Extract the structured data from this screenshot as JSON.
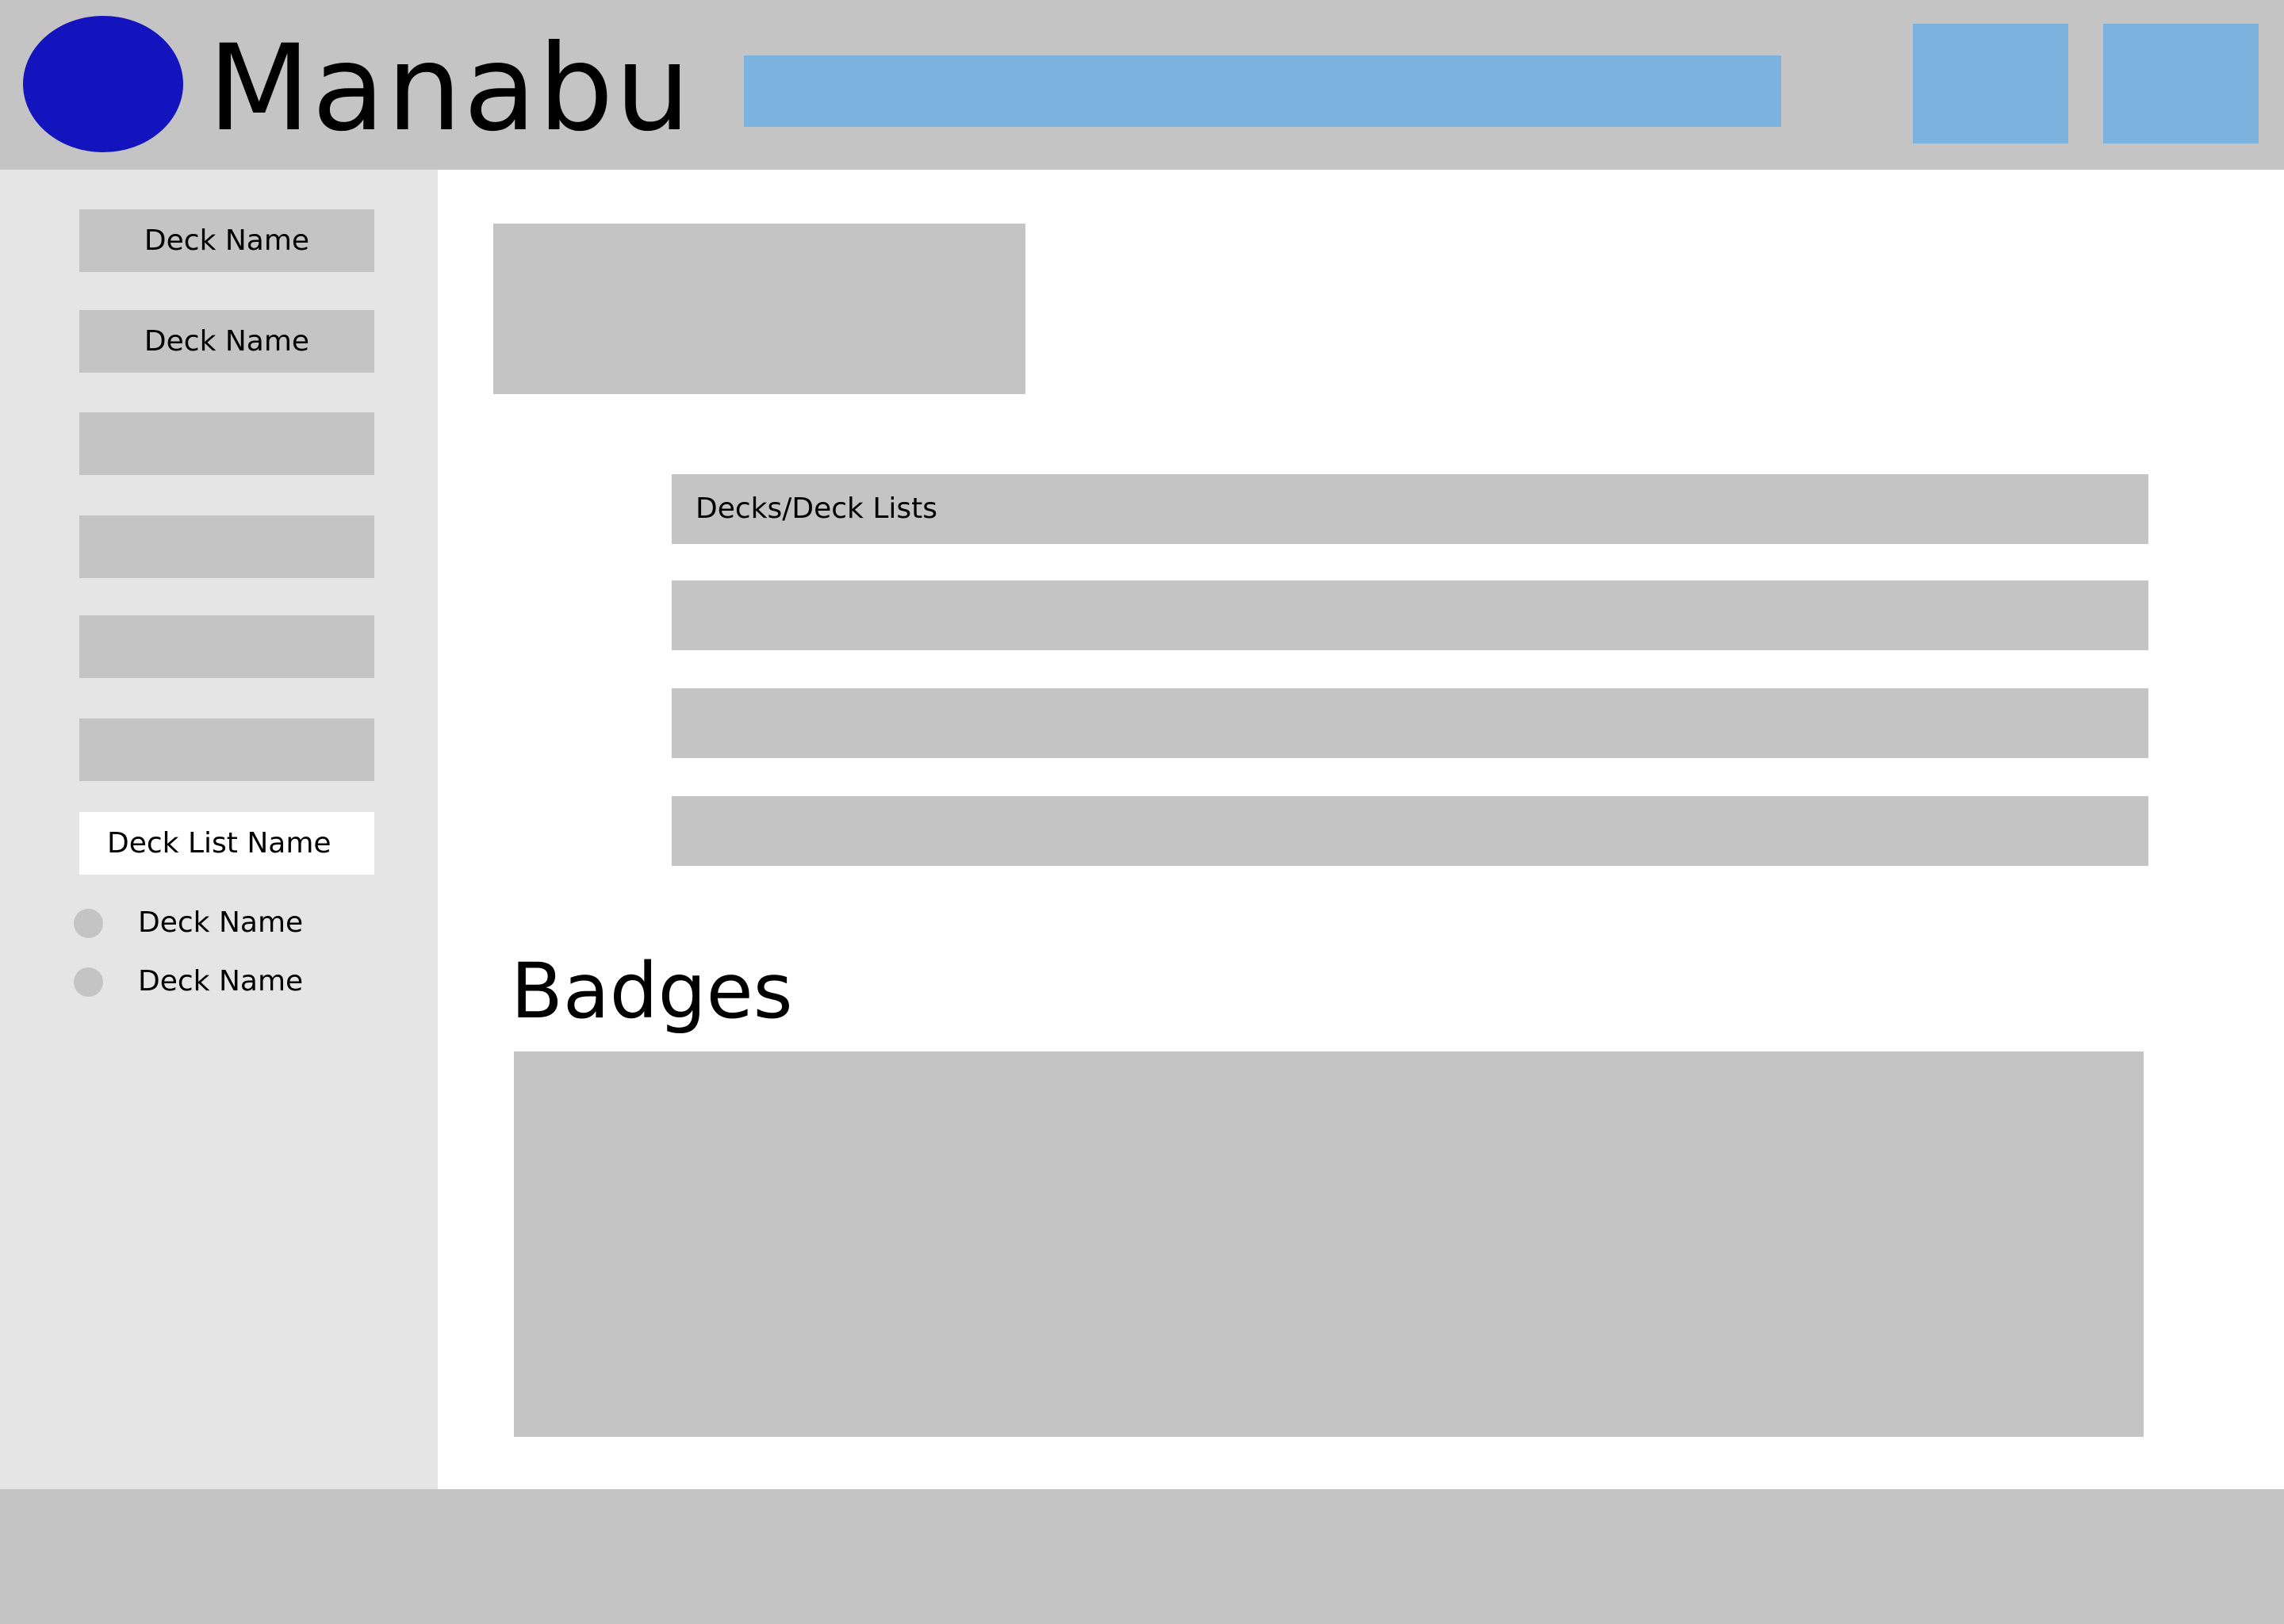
{
  "header": {
    "app_title": "Manabu",
    "search_placeholder": ""
  },
  "sidebar": {
    "items": [
      {
        "label": "Deck Name"
      },
      {
        "label": "Deck Name"
      },
      {
        "label": ""
      },
      {
        "label": ""
      },
      {
        "label": ""
      },
      {
        "label": ""
      }
    ],
    "deck_list": {
      "title": "Deck  List Name",
      "items": [
        {
          "label": "Deck Name"
        },
        {
          "label": "Deck Name"
        }
      ]
    }
  },
  "main": {
    "list": {
      "rows": [
        {
          "label": "Decks/Deck Lists"
        },
        {
          "label": ""
        },
        {
          "label": ""
        },
        {
          "label": ""
        }
      ]
    },
    "badges": {
      "title": "Badges"
    }
  },
  "colors": {
    "header_bg": "#c4c4c4",
    "logo": "#1414bf",
    "accent": "#7bb2de",
    "sidebar_bg": "#e5e5e5",
    "placeholder_gray": "#c4c4c4"
  }
}
